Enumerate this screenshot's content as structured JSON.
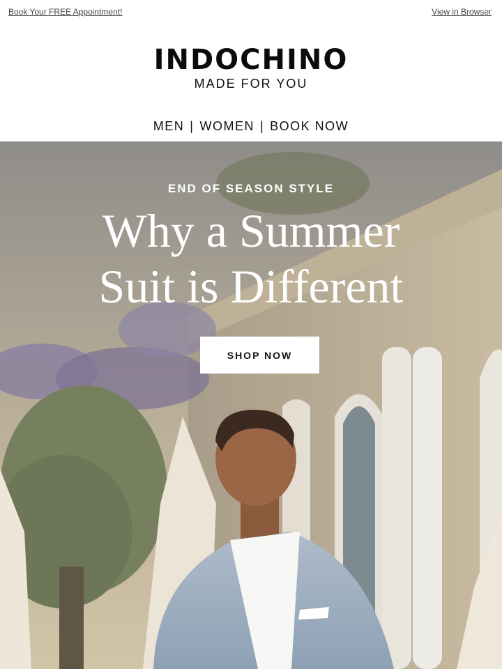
{
  "topbar": {
    "appointment_link": "Book Your FREE Appointment!",
    "view_browser_link": "View in Browser"
  },
  "brand": {
    "logo": "INDOCHINO",
    "tagline": "MADE FOR YOU"
  },
  "nav": {
    "items": [
      "MEN",
      "WOMEN",
      "BOOK NOW"
    ],
    "separator": "|"
  },
  "hero": {
    "eyebrow": "END OF SEASON STYLE",
    "headline_line1": "Why a Summer",
    "headline_line2": "Suit is Different",
    "cta_label": "SHOP NOW"
  }
}
